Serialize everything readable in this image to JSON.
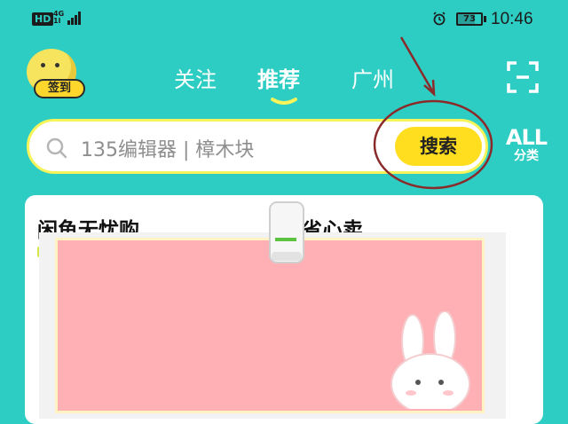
{
  "status_bar": {
    "hd": "HD",
    "network": "4G",
    "network_sub": "1l",
    "battery": "73",
    "time": "10:46"
  },
  "avatar": {
    "checkin_label": "签到"
  },
  "tabs": [
    {
      "label": "关注",
      "active": false
    },
    {
      "label": "推荐",
      "active": true
    },
    {
      "label": "广州",
      "active": false
    }
  ],
  "search": {
    "placeholder": "135编辑器 | 樟木块",
    "button_label": "搜索"
  },
  "all_category": {
    "top": "ALL",
    "bottom": "分类"
  },
  "card": {
    "title_left": "闲鱼无忧购",
    "title_right": "省心卖"
  },
  "colors": {
    "background": "#2ecdc3",
    "accent": "#ffdd1f",
    "annotation": "#8b2a2a",
    "popup": "#ffb0b4"
  },
  "icons": [
    "alarm-icon",
    "battery-icon",
    "search-icon",
    "scan-icon",
    "signal-icon",
    "bunny-icon"
  ]
}
